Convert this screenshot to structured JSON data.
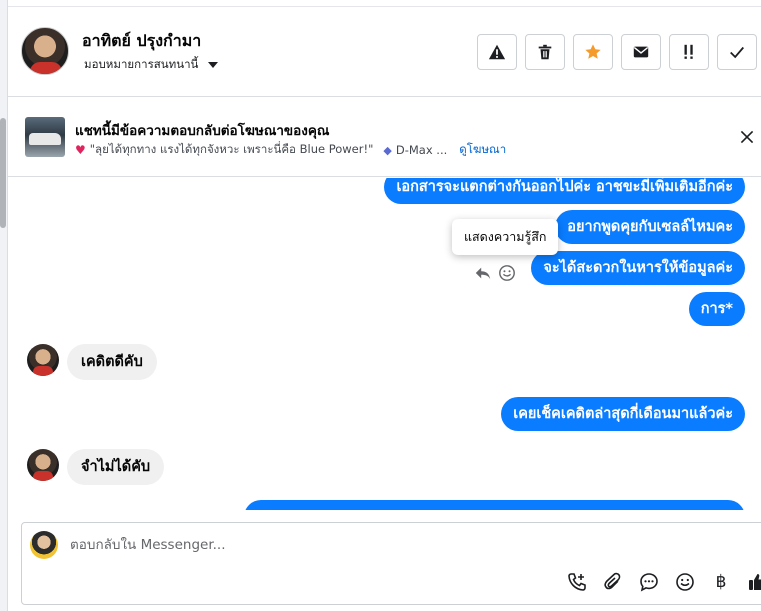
{
  "header": {
    "contact_name": "อาทิตย์ ปรุงกำมา",
    "assign_label": "มอบหมายการสนทนานี้",
    "actions": [
      {
        "name": "report-spam",
        "icon": "warning-icon"
      },
      {
        "name": "delete",
        "icon": "trash-icon"
      },
      {
        "name": "star",
        "icon": "star-icon"
      },
      {
        "name": "mark-unread",
        "icon": "envelope-icon"
      },
      {
        "name": "follow-up",
        "icon": "important-icon"
      },
      {
        "name": "mark-done",
        "icon": "check-icon"
      }
    ]
  },
  "ad_banner": {
    "title": "แชทนี้มีข้อความตอบกลับต่อโฆษณาของคุณ",
    "ad_text": "\"ลุยได้ทุกทาง แรงได้ทุกจังหวะ เพราะนี่คือ Blue Power!\"",
    "product": "D-Max ...",
    "view_ad_link": "ดูโฆษณา"
  },
  "tooltip": "แสดงความรู้สึก",
  "messages": [
    {
      "dir": "out",
      "text": "เอกสารจะแตกต่างกันออกไปค่ะ อาชขะมีเพิ่มเติมอีกค่ะ"
    },
    {
      "dir": "out",
      "text": "อยากพูดคุยกับเซลล์ไหมคะ"
    },
    {
      "dir": "out",
      "text": "จะได้สะดวกในหารให้ข้อมูลค่ะ"
    },
    {
      "dir": "out",
      "text": "การ*"
    },
    {
      "dir": "in",
      "text": "เคดิตดีคับ"
    },
    {
      "dir": "out",
      "text": "เคยเช็คเคดิตล่าสุดกี่เดือนมาแล้วค่ะ"
    },
    {
      "dir": "in",
      "text": "จำไม่ได้คับ"
    }
  ],
  "composer": {
    "placeholder": "ตอบกลับใน Messenger...",
    "baht_symbol": "฿"
  },
  "colors": {
    "outgoing_bubble": "#0a7cff",
    "incoming_bubble": "#f0f0f0",
    "star": "#f59b2b",
    "link": "#0064d1"
  }
}
